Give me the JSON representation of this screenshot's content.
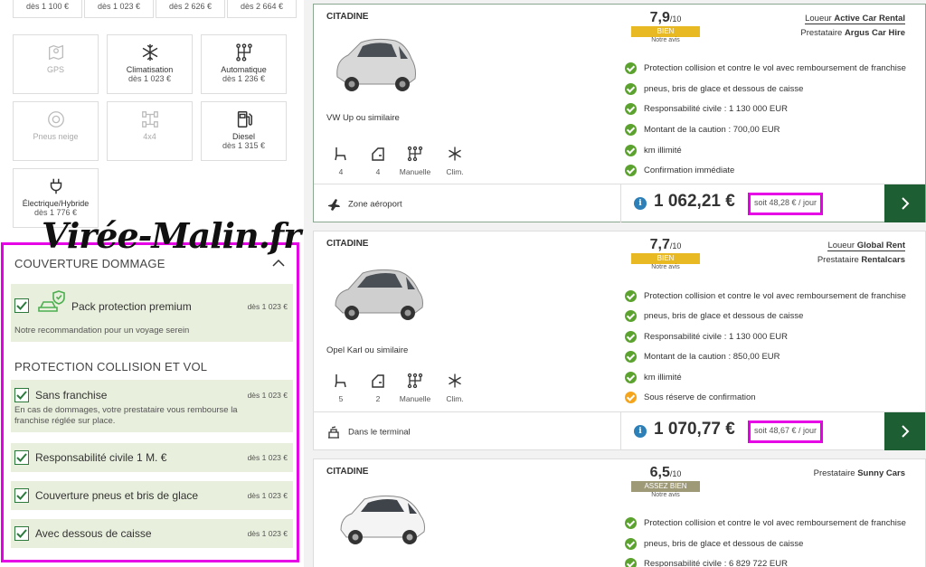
{
  "top_prices": [
    "dès 1 100 €",
    "dès 1 023 €",
    "dès 2 626 €",
    "dès 2 664 €"
  ],
  "filters": [
    {
      "label": "GPS",
      "price": "",
      "disabled": true,
      "icon": "gps-icon"
    },
    {
      "label": "Climatisation",
      "price": "dès 1 023 €",
      "disabled": false,
      "icon": "snowflake-icon"
    },
    {
      "label": "Automatique",
      "price": "dès 1 236 €",
      "disabled": false,
      "icon": "gearbox-icon"
    },
    {
      "label": "Pneus neige",
      "price": "",
      "disabled": true,
      "icon": "snow-tire-icon"
    },
    {
      "label": "4x4",
      "price": "",
      "disabled": true,
      "icon": "four-by-four-icon"
    },
    {
      "label": "Diesel",
      "price": "dès 1 315 €",
      "disabled": false,
      "icon": "fuel-pump-icon"
    },
    {
      "label": "Électrique/Hybride",
      "price": "dès 1 776 €",
      "disabled": false,
      "icon": "plug-icon"
    }
  ],
  "watermark": "Virée-Malin.fr",
  "coverage": {
    "title": "COUVERTURE DOMMAGE",
    "pack": {
      "label": "Pack protection premium",
      "price": "dès 1 023 €",
      "desc": "Notre recommandation pour un voyage serein"
    },
    "collision_title": "PROTECTION COLLISION ET VOL",
    "options": [
      {
        "label": "Sans franchise",
        "price": "dès 1 023 €",
        "desc": "En cas de dommages, votre prestataire vous rembourse la franchise réglée sur place."
      },
      {
        "label": "Responsabilité civile 1 M. €",
        "price": "dès 1 023 €",
        "desc": ""
      },
      {
        "label": "Couverture pneus et bris de glace",
        "price": "dès 1 023 €",
        "desc": ""
      },
      {
        "label": "Avec dessous de caisse",
        "price": "dès 1 023 €",
        "desc": ""
      }
    ]
  },
  "cars": [
    {
      "category": "CITADINE",
      "name": "VW Up ou similaire",
      "score": "7,9",
      "score_max": "/10",
      "rating": "BIEN",
      "rating_color": "#e8b923",
      "avis": "Notre avis",
      "loueur_label": "Loueur",
      "loueur": "Active Car Rental",
      "prestataire_label": "Prestataire",
      "prestataire": "Argus Car Hire",
      "features": [
        {
          "value": "4",
          "icon": "seat-icon"
        },
        {
          "value": "4",
          "icon": "door-icon"
        },
        {
          "value": "Manuelle",
          "icon": "gearbox-icon"
        },
        {
          "value": "Clim.",
          "icon": "snowflake-icon"
        }
      ],
      "bullets": [
        {
          "text": "Protection collision et contre le vol avec remboursement de franchise",
          "warn": false
        },
        {
          "text": "pneus, bris de glace et dessous de caisse",
          "warn": false
        },
        {
          "text": "Responsabilité civile : 1 130 000 EUR",
          "warn": false
        },
        {
          "text": "Montant de la caution : 700,00 EUR",
          "warn": false
        },
        {
          "text": "km illimité",
          "warn": false
        },
        {
          "text": "Confirmation immédiate",
          "warn": false
        }
      ],
      "location": "Zone aéroport",
      "location_icon": "plane-icon",
      "price": "1 062,21 €",
      "per_day": "soit 48,28 € / jour"
    },
    {
      "category": "CITADINE",
      "name": "Opel Karl ou similaire",
      "score": "7,7",
      "score_max": "/10",
      "rating": "BIEN",
      "rating_color": "#e8b923",
      "avis": "Notre avis",
      "loueur_label": "Loueur",
      "loueur": "Global Rent",
      "prestataire_label": "Prestataire",
      "prestataire": "Rentalcars",
      "features": [
        {
          "value": "5",
          "icon": "seat-icon"
        },
        {
          "value": "2",
          "icon": "door-icon"
        },
        {
          "value": "Manuelle",
          "icon": "gearbox-icon"
        },
        {
          "value": "Clim.",
          "icon": "snowflake-icon"
        }
      ],
      "bullets": [
        {
          "text": "Protection collision et contre le vol avec remboursement de franchise",
          "warn": false
        },
        {
          "text": "pneus, bris de glace et dessous de caisse",
          "warn": false
        },
        {
          "text": "Responsabilité civile : 1 130 000 EUR",
          "warn": false
        },
        {
          "text": "Montant de la caution : 850,00 EUR",
          "warn": false
        },
        {
          "text": "km illimité",
          "warn": false
        },
        {
          "text": "Sous réserve de confirmation",
          "warn": true
        }
      ],
      "location": "Dans le terminal",
      "location_icon": "terminal-icon",
      "price": "1 070,77 €",
      "per_day": "soit 48,67 € / jour"
    },
    {
      "category": "CITADINE",
      "name": "",
      "score": "6,5",
      "score_max": "/10",
      "rating": "ASSEZ BIEN",
      "rating_color": "#9e9a78",
      "avis": "Notre avis",
      "prestataire_label": "Prestataire",
      "prestataire": "Sunny Cars",
      "bullets": [
        {
          "text": "Protection collision et contre le vol avec remboursement de franchise",
          "warn": false
        },
        {
          "text": "pneus, bris de glace et dessous de caisse",
          "warn": false
        },
        {
          "text": "Responsabilité civile : 6 829 722 EUR",
          "warn": false
        }
      ]
    }
  ]
}
